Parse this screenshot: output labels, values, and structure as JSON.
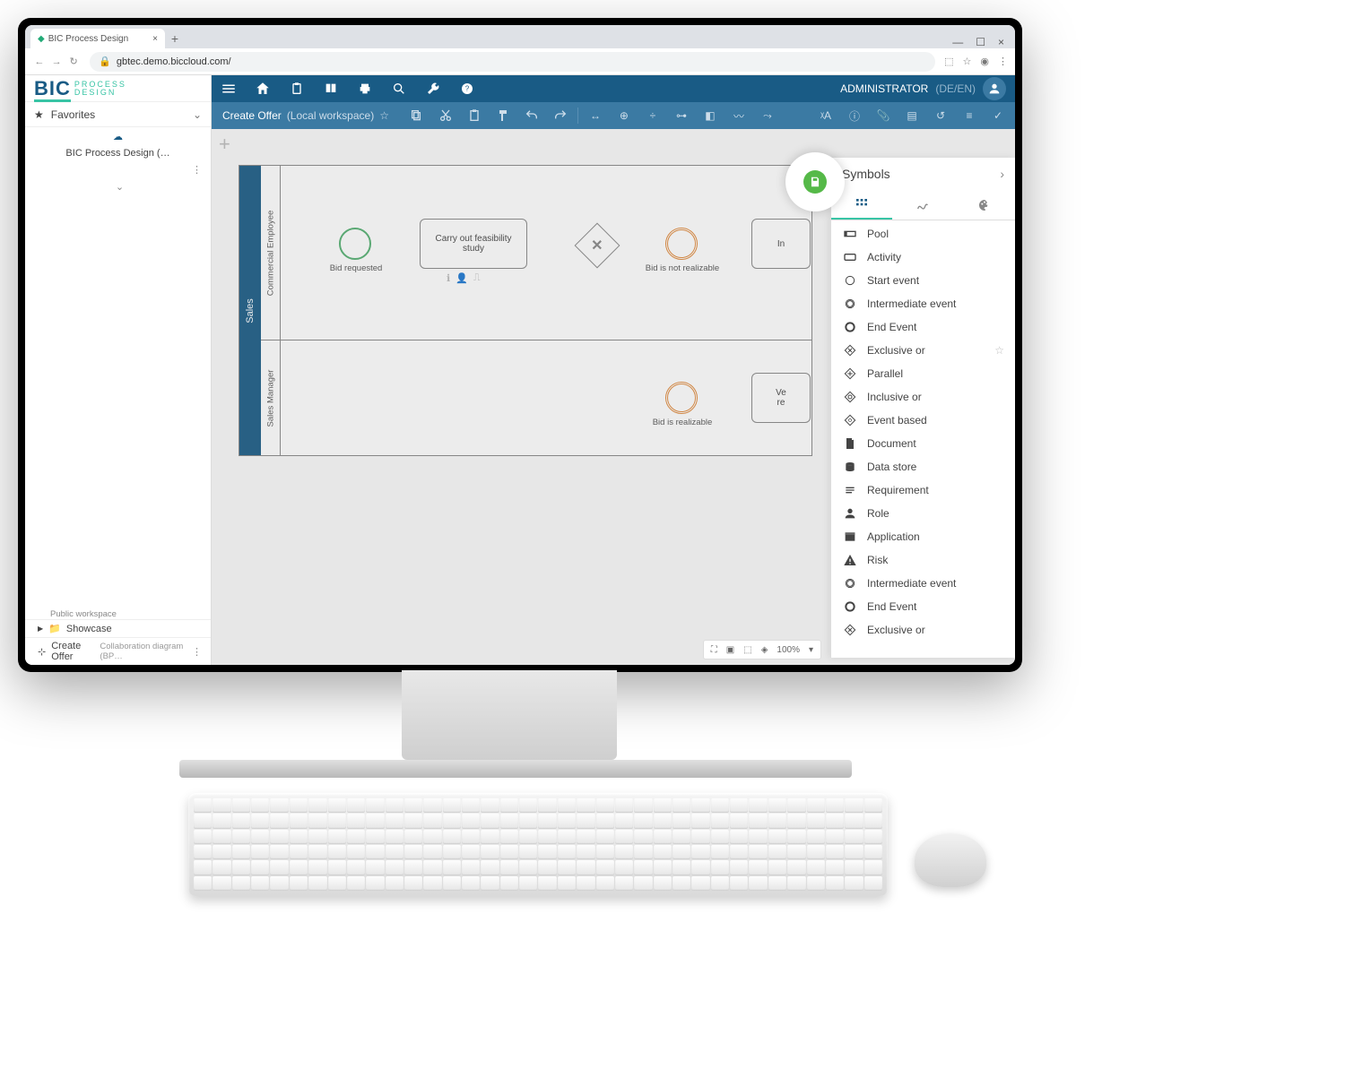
{
  "browser": {
    "tab_title": "BIC Process Design",
    "url": "gbtec.demo.biccloud.com/"
  },
  "logo": {
    "brand": "BIC",
    "sub1": "PROCESS",
    "sub2": "DESIGN"
  },
  "sidebar": {
    "favorites_label": "Favorites",
    "workspace_name": "BIC Process Design (…",
    "workspace_sub": "Public workspace",
    "showcase_label": "Showcase",
    "diagram_name": "Create Offer",
    "diagram_type": "Collaboration diagram (BP…"
  },
  "topbar": {
    "user_label": "ADMINISTRATOR",
    "lang": "(DE/EN)"
  },
  "ribbon": {
    "breadcrumb_title": "Create Offer",
    "breadcrumb_workspace": "(Local workspace)"
  },
  "canvas": {
    "pool_name": "Sales",
    "lane1_name": "Commercial Employee",
    "lane2_name": "Sales Manager",
    "start_label": "Bid requested",
    "task1_label": "Carry out feasibility study",
    "inter1_label": "Bid is not realizable",
    "inter2_label": "Bid is realizable",
    "task2_prefix": "In",
    "task3_line1": "Ve",
    "task3_line2": "re"
  },
  "symbols": {
    "title": "Symbols",
    "items": [
      {
        "label": "Pool",
        "icon": "pool"
      },
      {
        "label": "Activity",
        "icon": "activity"
      },
      {
        "label": "Start event",
        "icon": "start"
      },
      {
        "label": "Intermediate event",
        "icon": "inter"
      },
      {
        "label": "End Event",
        "icon": "end"
      },
      {
        "label": "Exclusive or",
        "icon": "xor",
        "star": true
      },
      {
        "label": "Parallel",
        "icon": "parallel"
      },
      {
        "label": "Inclusive or",
        "icon": "inclusive"
      },
      {
        "label": "Event based",
        "icon": "eventbased"
      },
      {
        "label": "Document",
        "icon": "doc"
      },
      {
        "label": "Data store",
        "icon": "store"
      },
      {
        "label": "Requirement",
        "icon": "req"
      },
      {
        "label": "Role",
        "icon": "role"
      },
      {
        "label": "Application",
        "icon": "app"
      },
      {
        "label": "Risk",
        "icon": "risk"
      },
      {
        "label": "Intermediate event",
        "icon": "inter"
      },
      {
        "label": "End Event",
        "icon": "end"
      },
      {
        "label": "Exclusive or",
        "icon": "xor"
      }
    ]
  },
  "status": {
    "zoom": "100%"
  }
}
